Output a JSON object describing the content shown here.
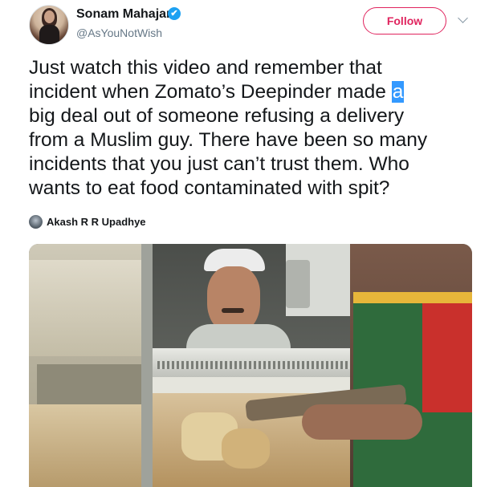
{
  "header": {
    "display_name": "Sonam Mahajan",
    "handle": "@AsYouNotWish",
    "verified_glyph": "✔",
    "follow_label": "Follow",
    "follow_color": "#e0245e",
    "menu_icon": "chevron-down-icon"
  },
  "tweet": {
    "lines": [
      "Just watch this video and remember that",
      "incident when Zomato’s Deepinder made ",
      "big deal out of someone refusing a delivery",
      "from a Muslim guy. There have been so many",
      "incidents that you just can’t trust them. Who",
      "wants to eat food contaminated with spit?"
    ],
    "highlighted_word": "a",
    "highlight_color": "#3399ff"
  },
  "quoted": {
    "author": "Akash R R Upadhye"
  },
  "media": {
    "type": "video-still",
    "icon": "video-frame"
  }
}
